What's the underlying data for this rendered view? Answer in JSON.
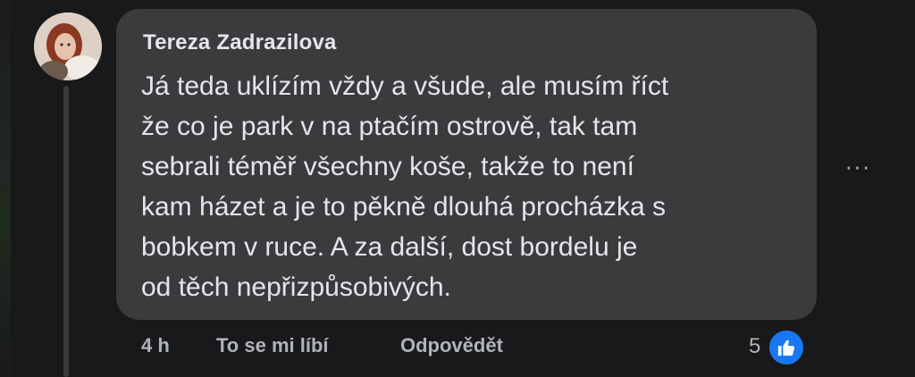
{
  "comment": {
    "author": "Tereza Zadrazilova",
    "text_lines": [
      "Já teda uklízím vždy a všude, ale musím říct",
      "že co je park v na ptačím ostrově, tak tam",
      "sebrali téměř všechny koše, takže to není",
      "kam házet a je to pěkně dlouhá procházka s",
      "bobkem v ruce. A za další, dost bordelu je",
      "od těch nepřizpůsobivých."
    ],
    "more_icon": "···"
  },
  "actions": {
    "timestamp": "4 h",
    "like_label": "To se mi líbí",
    "reply_label": "Odpovědět",
    "reaction_count": "5"
  },
  "icons": {
    "avatar": "profile-photo",
    "like_reaction": "thumbs-up-icon",
    "more": "ellipsis-icon"
  },
  "colors": {
    "background": "#18191a",
    "bubble": "#3a3b3c",
    "text": "#e4e6eb",
    "secondary_text": "#b0b3b8",
    "like_blue": "#1877f2"
  }
}
